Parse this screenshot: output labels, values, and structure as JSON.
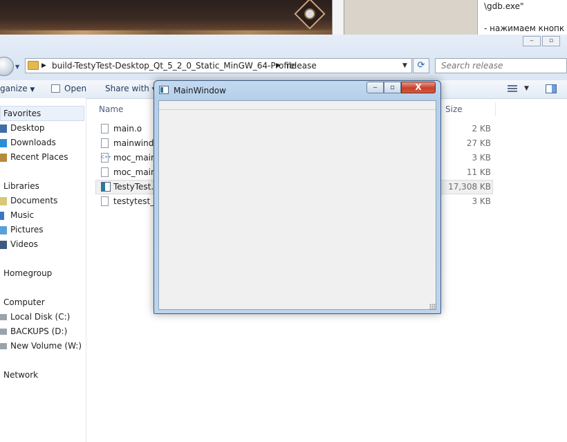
{
  "background": {
    "right_text_line1": "\\gdb.exe\"",
    "right_text_line2": "- нажимаем кнопк"
  },
  "explorer": {
    "path": [
      "build-TestyTest-Desktop_Qt_5_2_0_Static_MinGW_64-Profile",
      "release"
    ],
    "search_placeholder": "Search release",
    "toolbar": {
      "organize": "ganize",
      "open": "Open",
      "share": "Share with"
    },
    "sidebar": {
      "favorites_header": "Favorites",
      "favorites": [
        "Desktop",
        "Downloads",
        "Recent Places"
      ],
      "libraries_header": "Libraries",
      "libraries": [
        "Documents",
        "Music",
        "Pictures",
        "Videos"
      ],
      "homegroup": "Homegroup",
      "computer_header": "Computer",
      "drives": [
        "Local Disk (C:)",
        "BACKUPS (D:)",
        "New Volume (W:)"
      ],
      "network": "Network"
    },
    "columns": {
      "name": "Name",
      "size": "Size"
    },
    "files": [
      {
        "name": "main.o",
        "size": "2 KB"
      },
      {
        "name": "mainwindo",
        "size": "27 KB"
      },
      {
        "name": "moc_mainv",
        "size": "3 KB"
      },
      {
        "name": "moc_mainv",
        "size": "11 KB"
      },
      {
        "name": "TestyTest.e",
        "size": "17,308 KB"
      },
      {
        "name": "testytest_pl",
        "size": "3 KB"
      }
    ]
  },
  "dialog": {
    "title": "MainWindow",
    "close_glyph": "X"
  },
  "colors": {
    "accent": "#3b5a82",
    "close_red": "#c4412c",
    "selection": "#f0f0f0"
  }
}
